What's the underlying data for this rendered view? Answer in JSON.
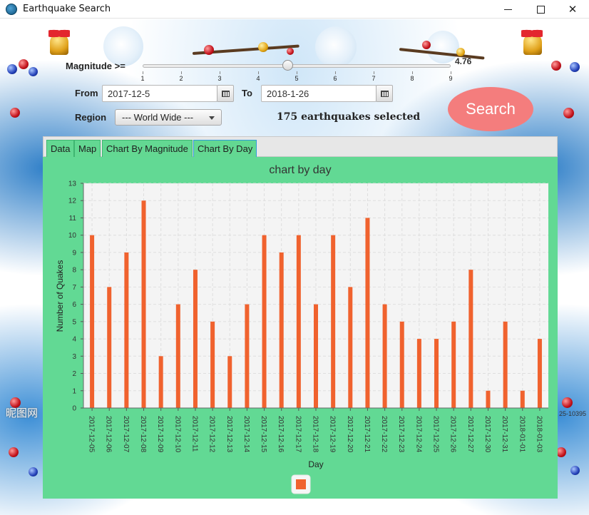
{
  "window": {
    "title": "Earthquake Search"
  },
  "controls": {
    "magnitude_label": "Magnitude >=",
    "magnitude_value": "4.76",
    "magnitude_fraction": 0.47,
    "slider_ticks": [
      "1",
      "2",
      "3",
      "4",
      "5",
      "6",
      "7",
      "8",
      "9"
    ],
    "from_label": "From",
    "from_value": "2017-12-5",
    "to_label": "To",
    "to_value": "2018-1-26",
    "region_label": "Region",
    "region_value": "--- World Wide ---",
    "selected_text": "175 earthquakes selected",
    "search_label": "Search"
  },
  "tabs": [
    {
      "label": "Data",
      "active": false
    },
    {
      "label": "Map",
      "active": false
    },
    {
      "label": "Chart By Magnitude",
      "active": false
    },
    {
      "label": "Chart By Day",
      "active": true
    }
  ],
  "background": {
    "watermark_left": "昵图网",
    "watermark_right": "25-10395"
  },
  "colors": {
    "bar": "#f0622e",
    "panel": "#62d994",
    "plot_bg": "#f4f4f4",
    "search": "#f47d7d"
  },
  "chart_data": {
    "type": "bar",
    "title": "chart by day",
    "xlabel": "Day",
    "ylabel": "Number of Quakes",
    "ylim": [
      0,
      13
    ],
    "yticks": [
      0,
      1,
      2,
      3,
      4,
      5,
      6,
      7,
      8,
      9,
      10,
      11,
      12,
      13
    ],
    "grid": true,
    "legend": "bottom-center",
    "categories": [
      "2017-12-05",
      "2017-12-06",
      "2017-12-07",
      "2017-12-08",
      "2017-12-09",
      "2017-12-10",
      "2017-12-11",
      "2017-12-12",
      "2017-12-13",
      "2017-12-14",
      "2017-12-15",
      "2017-12-16",
      "2017-12-17",
      "2017-12-18",
      "2017-12-19",
      "2017-12-20",
      "2017-12-21",
      "2017-12-22",
      "2017-12-23",
      "2017-12-24",
      "2017-12-25",
      "2017-12-26",
      "2017-12-27",
      "2017-12-30",
      "2017-12-31",
      "2018-01-01",
      "2018-01-03"
    ],
    "values": [
      10,
      7,
      9,
      12,
      3,
      6,
      8,
      5,
      3,
      6,
      10,
      9,
      10,
      6,
      10,
      7,
      11,
      6,
      5,
      4,
      4,
      5,
      8,
      1,
      5,
      1,
      4
    ]
  }
}
